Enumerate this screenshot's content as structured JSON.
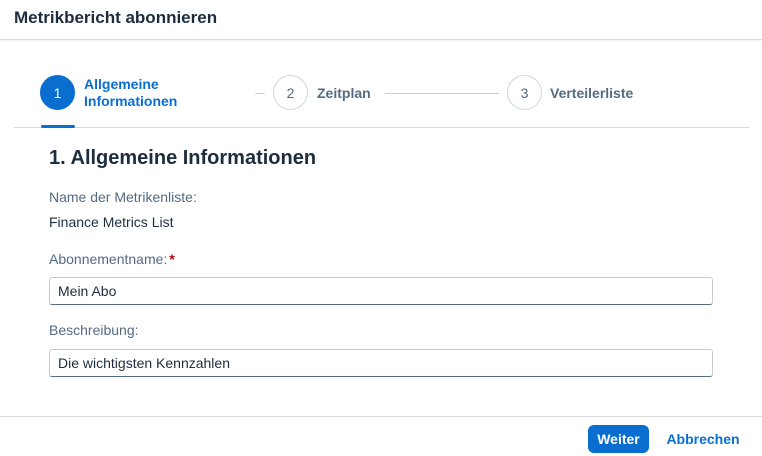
{
  "dialog": {
    "title": "Metrikbericht abonnieren"
  },
  "wizard": {
    "steps": [
      {
        "number": "1",
        "label_line1": "Allgemeine",
        "label_line2": "Informationen",
        "state": "active"
      },
      {
        "number": "2",
        "label": "Zeitplan",
        "state": "inactive"
      },
      {
        "number": "3",
        "label": "Verteilerliste",
        "state": "inactive"
      }
    ]
  },
  "form": {
    "section_title": "1. Allgemeine Informationen",
    "metric_list": {
      "label": "Name der Metrikenliste:",
      "value": "Finance Metrics List"
    },
    "subscription_name": {
      "label": "Abonnementname:",
      "required_mark": "*",
      "value": "Mein Abo"
    },
    "description": {
      "label": "Beschreibung:",
      "value": "Die wichtigsten Kennzahlen"
    }
  },
  "footer": {
    "next_label": "Weiter",
    "cancel_label": "Abbrechen"
  },
  "colors": {
    "accent": "#0a6ed1",
    "required": "#aa0808",
    "label": "#556b82",
    "text": "#1d2d3e"
  }
}
